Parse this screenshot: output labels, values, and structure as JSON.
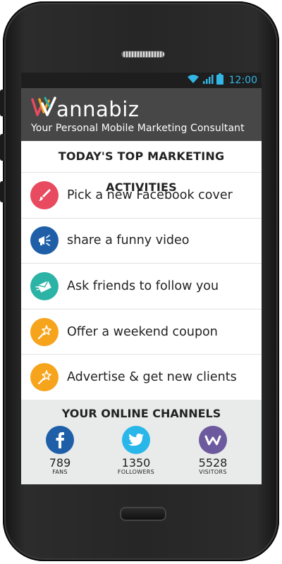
{
  "status_bar": {
    "time": "12:00",
    "wifi_icon": "wifi-icon",
    "signal_icon": "signal-icon",
    "battery_icon": "battery-icon",
    "accent": "#33b5e5"
  },
  "header": {
    "app_name": "annabiz",
    "tagline": "Your Personal Mobile Marketing Consultant",
    "background": "#474747"
  },
  "activities": {
    "title": "TODAY'S TOP MARKETING ACTIVITIES",
    "items": [
      {
        "label": "Pick a new Facebook cover",
        "icon": "paintbrush-icon",
        "color": "#e84a5f"
      },
      {
        "label": "share a funny video",
        "icon": "megaphone-icon",
        "color": "#1f5fa8"
      },
      {
        "label": "Ask friends to follow you",
        "icon": "envelope-icon",
        "color": "#2bb3a5"
      },
      {
        "label": "Offer a weekend coupon",
        "icon": "magic-wand-icon",
        "color": "#f7a41d"
      },
      {
        "label": "Advertise & get new clients",
        "icon": "magic-wand-icon",
        "color": "#f7a41d"
      }
    ]
  },
  "channels": {
    "title": "YOUR ONLINE CHANNELS",
    "items": [
      {
        "name": "facebook",
        "icon": "facebook-icon",
        "count": "789",
        "unit": "FANS",
        "color": "#1f5fa8"
      },
      {
        "name": "twitter",
        "icon": "twitter-icon",
        "count": "1350",
        "unit": "FOLLOWERS",
        "color": "#29b6e8"
      },
      {
        "name": "wannabiz",
        "icon": "wannabiz-icon",
        "count": "5528",
        "unit": "VISITORS",
        "color": "#6d5a9e"
      }
    ]
  }
}
